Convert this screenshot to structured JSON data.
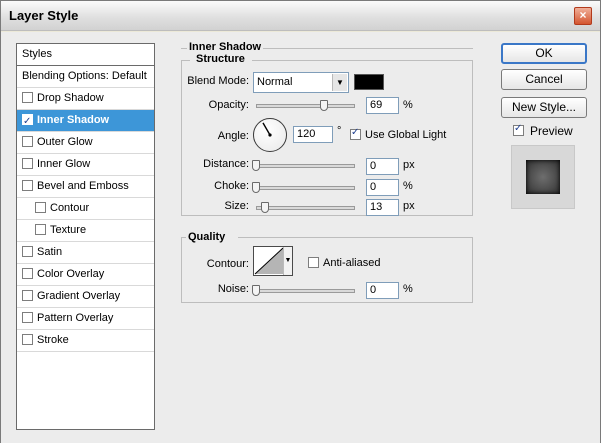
{
  "window": {
    "title": "Layer Style",
    "close": "×"
  },
  "styles": {
    "header": "Styles",
    "items": [
      {
        "label": "Blending Options: Default",
        "checkbox": false,
        "checked": false
      },
      {
        "label": "Drop Shadow",
        "checkbox": true,
        "checked": false
      },
      {
        "label": "Inner Shadow",
        "checkbox": true,
        "checked": true,
        "selected": true
      },
      {
        "label": "Outer Glow",
        "checkbox": true,
        "checked": false
      },
      {
        "label": "Inner Glow",
        "checkbox": true,
        "checked": false
      },
      {
        "label": "Bevel and Emboss",
        "checkbox": true,
        "checked": false
      },
      {
        "label": "Contour",
        "checkbox": true,
        "checked": false,
        "indent": true
      },
      {
        "label": "Texture",
        "checkbox": true,
        "checked": false,
        "indent": true
      },
      {
        "label": "Satin",
        "checkbox": true,
        "checked": false
      },
      {
        "label": "Color Overlay",
        "checkbox": true,
        "checked": false
      },
      {
        "label": "Gradient Overlay",
        "checkbox": true,
        "checked": false
      },
      {
        "label": "Pattern Overlay",
        "checkbox": true,
        "checked": false
      },
      {
        "label": "Stroke",
        "checkbox": true,
        "checked": false
      }
    ]
  },
  "inner_shadow": {
    "title": "Inner Shadow",
    "structure": {
      "title": "Structure",
      "blend_mode_label": "Blend Mode:",
      "blend_mode_value": "Normal",
      "shadow_color": "#000000",
      "opacity_label": "Opacity:",
      "opacity_value": "69",
      "opacity_unit": "%",
      "opacity_fraction": 0.69,
      "angle_label": "Angle:",
      "angle_value": "120",
      "angle_unit": "°",
      "angle_degrees": 120,
      "use_global_light_label": "Use Global Light",
      "use_global_light_checked": true,
      "distance_label": "Distance:",
      "distance_value": "0",
      "distance_unit": "px",
      "choke_label": "Choke:",
      "choke_value": "0",
      "choke_unit": "%",
      "size_label": "Size:",
      "size_value": "13",
      "size_unit": "px"
    },
    "quality": {
      "title": "Quality",
      "contour_label": "Contour:",
      "anti_aliased_label": "Anti-aliased",
      "anti_aliased_checked": false,
      "noise_label": "Noise:",
      "noise_value": "0",
      "noise_unit": "%"
    }
  },
  "buttons": {
    "ok": "OK",
    "cancel": "Cancel",
    "new_style": "New Style...",
    "preview_label": "Preview",
    "preview_checked": true
  },
  "colors": {
    "selection": "#3d96d8",
    "default_button_border": "#3a77c7"
  }
}
